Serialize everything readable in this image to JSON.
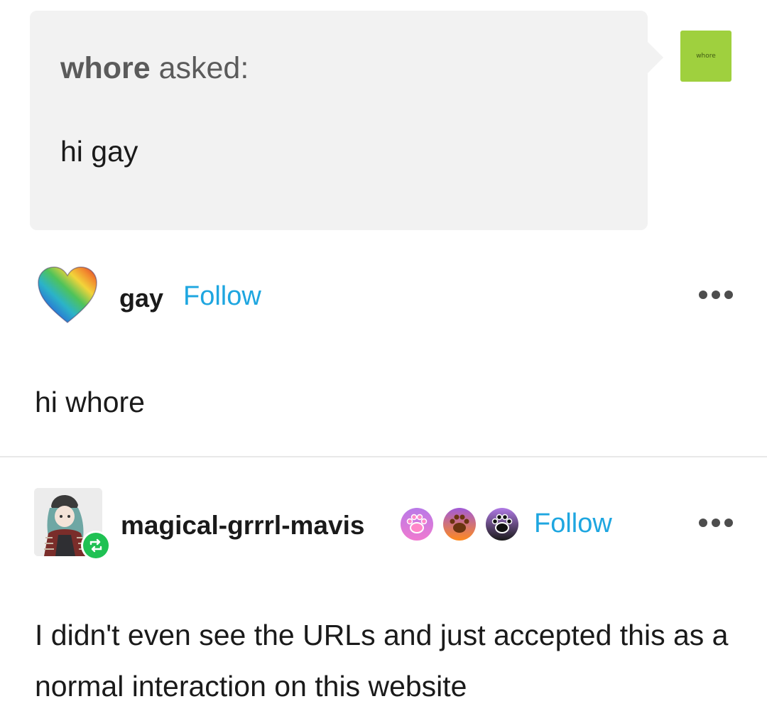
{
  "ask": {
    "asker_name": "whore",
    "asked_label": " asked:",
    "question": "hi gay",
    "asker_avatar_label": "whore",
    "asker_avatar_color": "#9fd03e"
  },
  "post1": {
    "username": "gay",
    "follow_label": "Follow",
    "avatar_icon": "rainbow-heart-icon",
    "reply": "hi whore"
  },
  "post2": {
    "username": "magical-grrrl-mavis",
    "follow_label": "Follow",
    "avatar_icon": "anime-girl-avatar",
    "badges": [
      "paw-badge-pink",
      "paw-badge-orange",
      "paw-badge-black"
    ],
    "reblog_icon": "reblog-icon",
    "body": "I didn't even see the URLs and just accepted this as a normal interaction on this website"
  },
  "colors": {
    "follow": "#1ea6e0",
    "bubble": "#f2f2f2",
    "reblog": "#1fc153"
  }
}
